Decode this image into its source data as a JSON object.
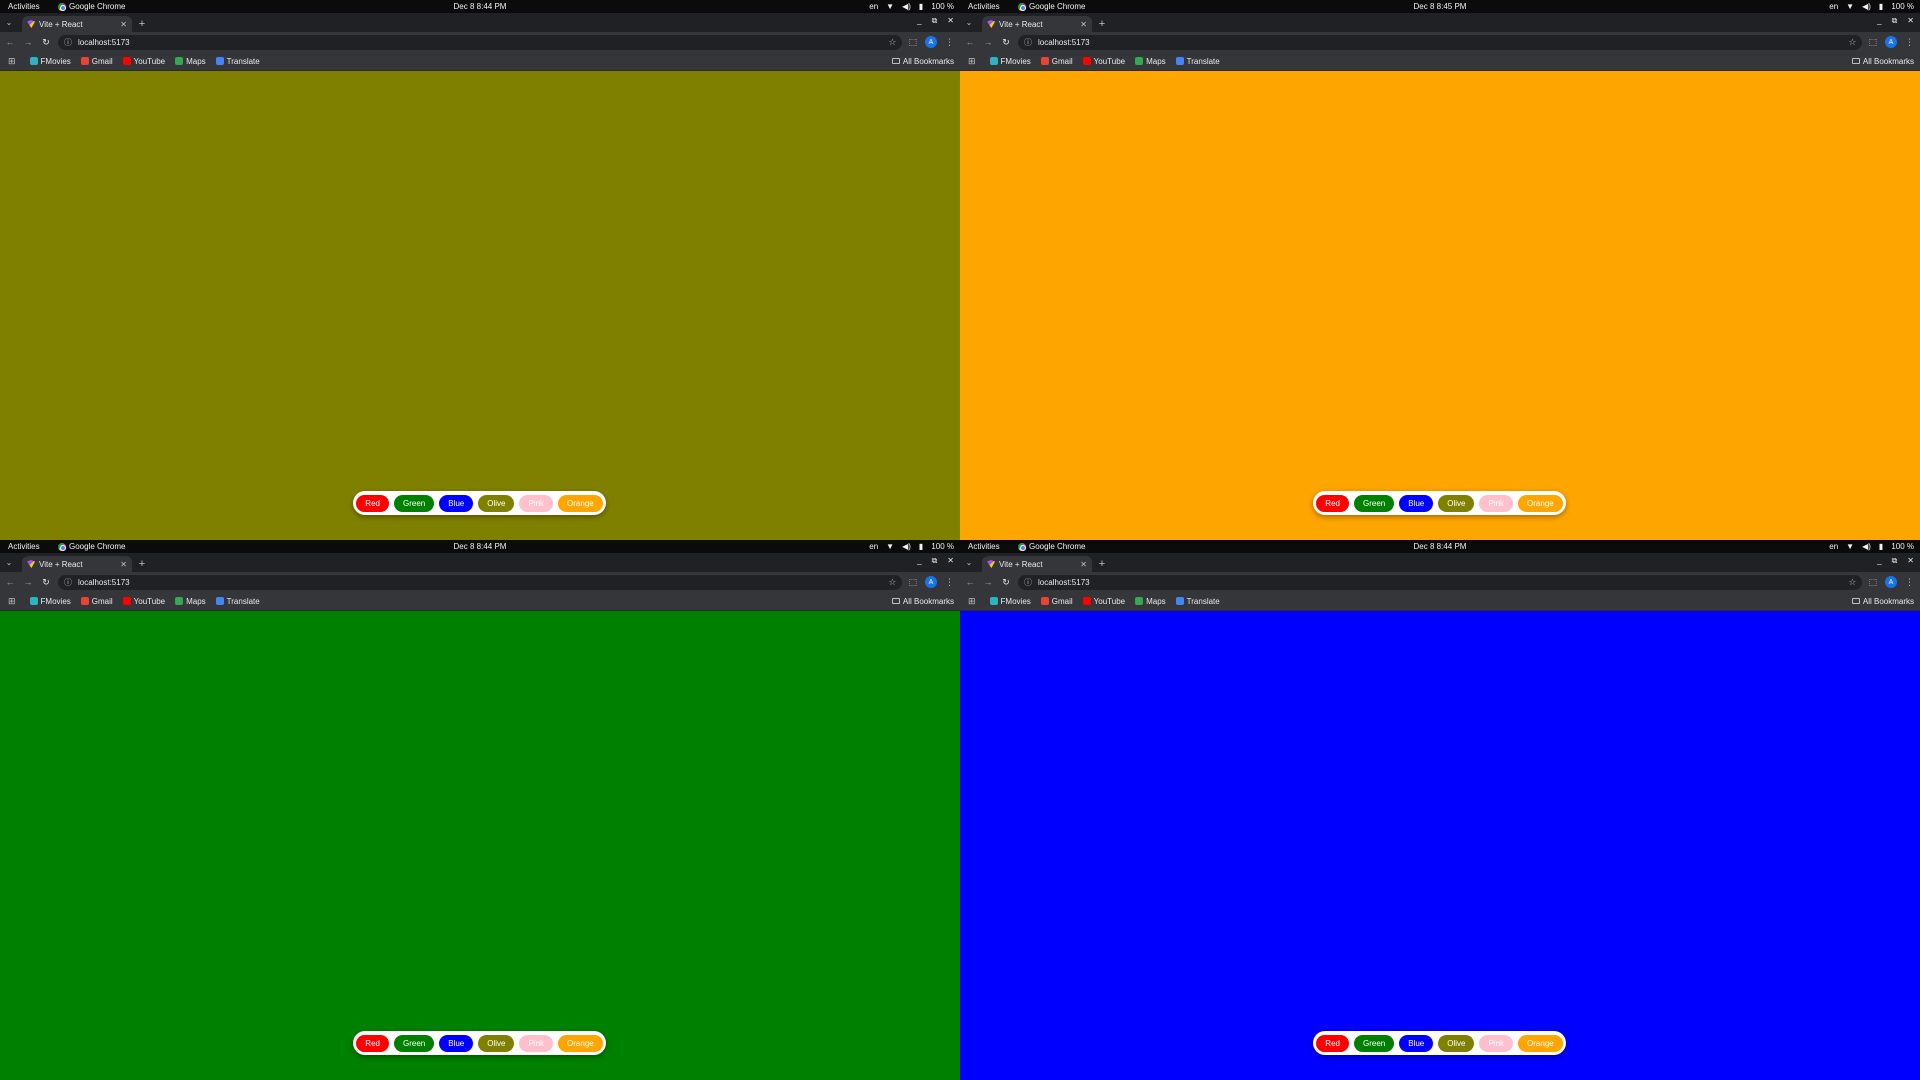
{
  "topbar_common": {
    "activities": "Activities",
    "app_name": "Google Chrome",
    "lang": "en",
    "battery": "100 %"
  },
  "browser_common": {
    "tab_title": "Vite + React",
    "url": "localhost:5173",
    "bookmarks": [
      {
        "label": "FMovies",
        "color": "#2bb3c0"
      },
      {
        "label": "Gmail",
        "color": "#ea4335"
      },
      {
        "label": "YouTube",
        "color": "#ff0000"
      },
      {
        "label": "Maps",
        "color": "#34a853"
      },
      {
        "label": "Translate",
        "color": "#4285f4"
      }
    ],
    "all_bookmarks": "All Bookmarks",
    "profile_initial": "A"
  },
  "color_buttons": [
    {
      "label": "Red",
      "bg": "#ff0000",
      "fg": "#ffffff"
    },
    {
      "label": "Green",
      "bg": "#008000",
      "fg": "#ffffff"
    },
    {
      "label": "Blue",
      "bg": "#0000ff",
      "fg": "#ffffff"
    },
    {
      "label": "Olive",
      "bg": "#808000",
      "fg": "#ffffff"
    },
    {
      "label": "Pink",
      "bg": "#ffc0cb",
      "fg": "#ffffff"
    },
    {
      "label": "Orange",
      "bg": "#ffa500",
      "fg": "#ffffff"
    }
  ],
  "panels": [
    {
      "clock": "Dec 8  8:45 PM",
      "background": "#ffa500"
    },
    {
      "clock": "Dec 8  8:44 PM",
      "background": "#008000"
    },
    {
      "clock": "Dec 8  8:44 PM",
      "background": "#0000ff"
    },
    {
      "clock": "Dec 8  8:44 PM",
      "background": "#808000"
    }
  ]
}
